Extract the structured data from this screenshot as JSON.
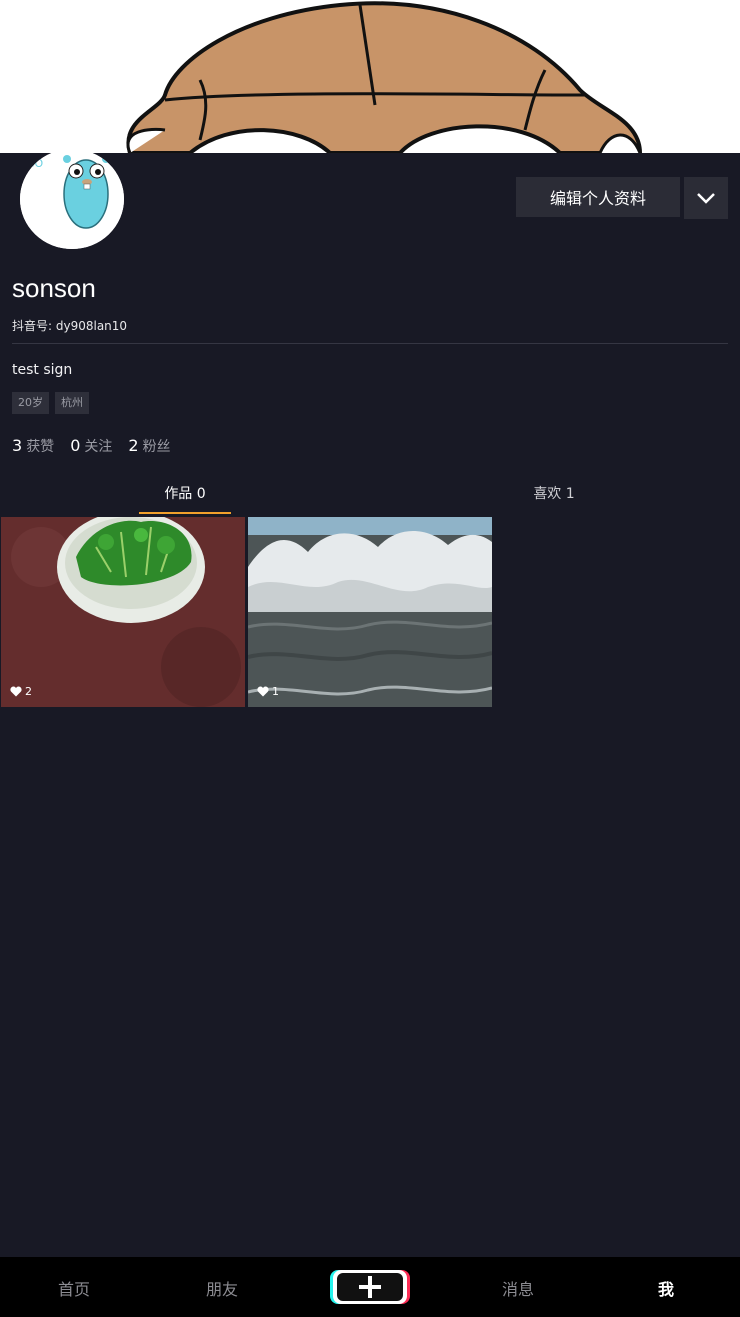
{
  "profile": {
    "edit_label": "编辑个人资料",
    "name": "sonson",
    "account_id": "抖音号: dy908lan10",
    "signature": "test sign",
    "tags": [
      "20岁",
      "杭州"
    ],
    "stats": [
      {
        "value": "3",
        "label": "获赞"
      },
      {
        "value": "0",
        "label": "关注"
      },
      {
        "value": "2",
        "label": "粉丝"
      }
    ]
  },
  "tabs": {
    "works": "作品 0",
    "likes": "喜欢 1"
  },
  "videos": [
    {
      "likes": "2",
      "subject": "bowl of greens"
    },
    {
      "likes": "1",
      "subject": "ocean waves"
    }
  ],
  "nav": {
    "home": "首页",
    "friends": "朋友",
    "messages": "消息",
    "me": "我"
  },
  "colors": {
    "background": "#181925",
    "tab_indicator": "#f1a02b",
    "tabbar": "#000000"
  },
  "icons": [
    "chevron-down-icon",
    "heart-icon",
    "plus-icon"
  ]
}
